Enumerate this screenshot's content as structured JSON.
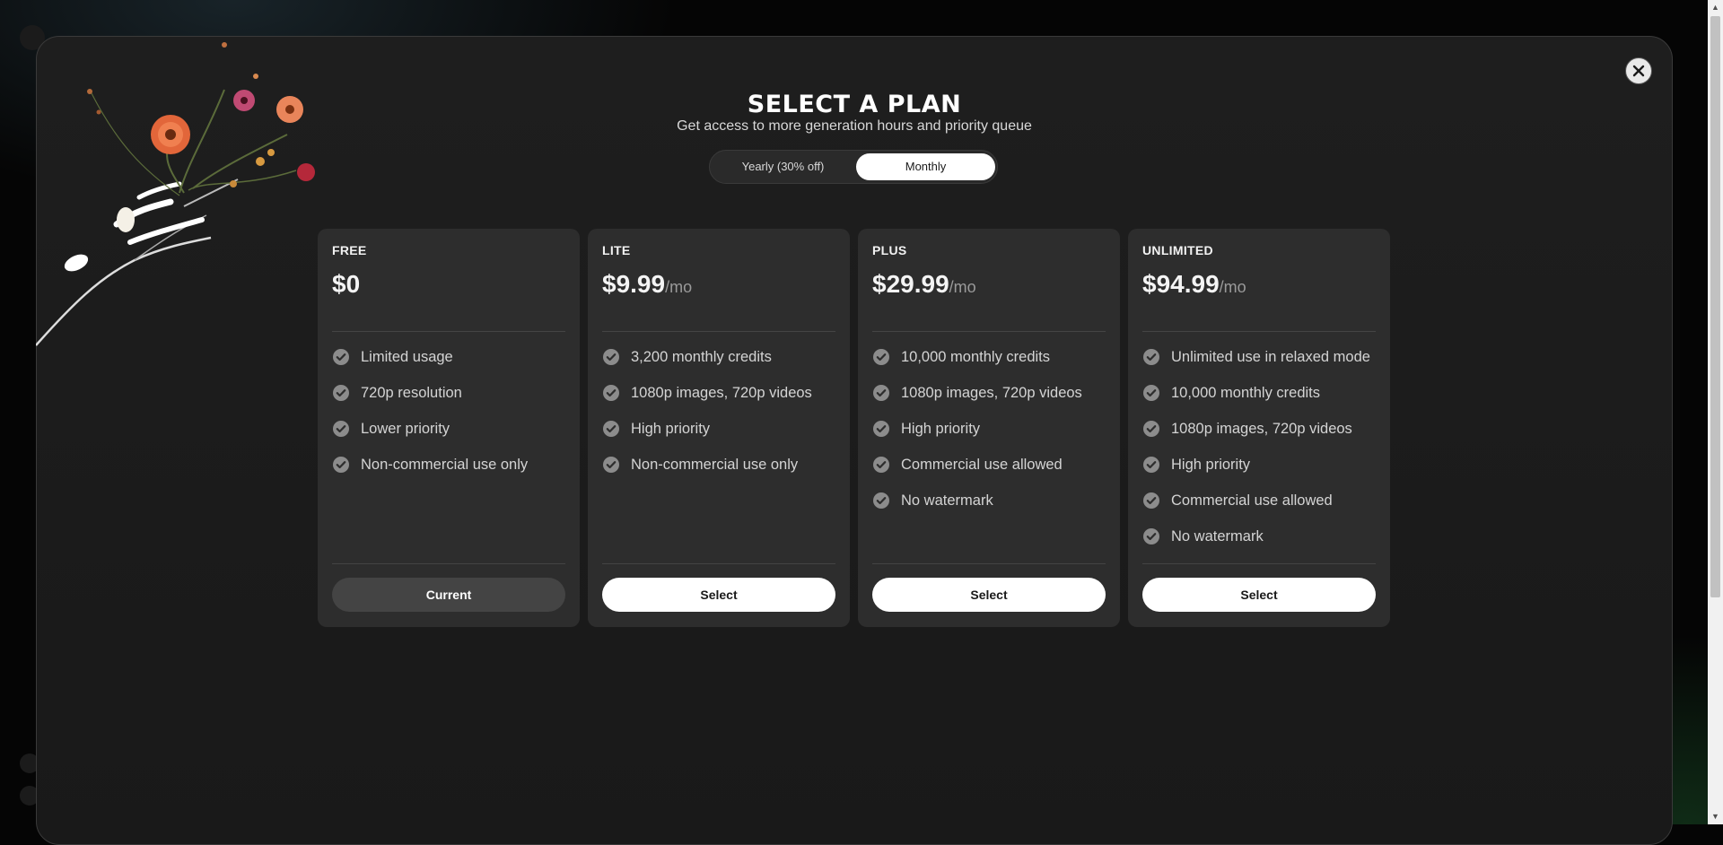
{
  "modal": {
    "title": "SELECT A PLAN",
    "subtitle": "Get access to more generation hours and priority queue",
    "close_icon": "close-icon"
  },
  "billing_toggle": {
    "yearly_label": "Yearly (30% off)",
    "monthly_label": "Monthly",
    "selected": "Monthly"
  },
  "plans": [
    {
      "name": "FREE",
      "price": "$0",
      "period": "",
      "features": [
        "Limited usage",
        "720p resolution",
        "Lower priority",
        "Non-commercial use only"
      ],
      "button_label": "Current"
    },
    {
      "name": "LITE",
      "price": "$9.99",
      "period": "/mo",
      "features": [
        "3,200 monthly credits",
        "1080p images, 720p videos",
        "High priority",
        "Non-commercial use only"
      ],
      "button_label": "Select"
    },
    {
      "name": "PLUS",
      "price": "$29.99",
      "period": "/mo",
      "features": [
        "10,000 monthly credits",
        "1080p images, 720p videos",
        "High priority",
        "Commercial use allowed",
        "No watermark"
      ],
      "button_label": "Select"
    },
    {
      "name": "UNLIMITED",
      "price": "$94.99",
      "period": "/mo",
      "features": [
        "Unlimited use in relaxed mode",
        "10,000 monthly credits",
        "1080p images, 720p videos",
        "High priority",
        "Commercial use allowed",
        "No watermark"
      ],
      "button_label": "Select"
    }
  ],
  "icons": {
    "feature": "check-circle-icon",
    "decoration": "flower-bouquet-illustration"
  },
  "colors": {
    "modal_bg": "#1e1e1e",
    "card_bg": "#2d2d2d",
    "button_primary": "#ffffff",
    "button_current": "#444444"
  }
}
